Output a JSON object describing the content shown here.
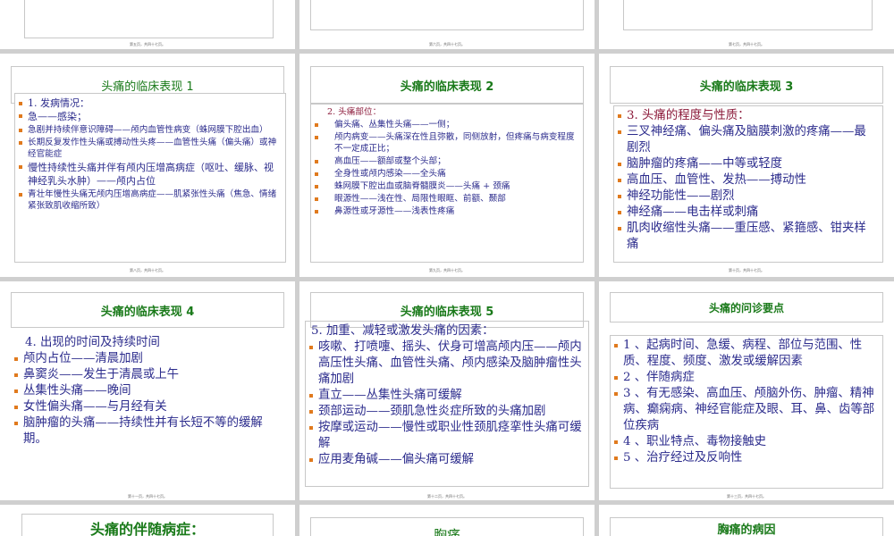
{
  "page_footers": {
    "top_left": "第五页，共四十七页。",
    "top_middle": "第六页，共四十七页。",
    "top_right": "第七页，共四十七页。"
  },
  "top_middle_text": "……………",
  "slides": [
    {
      "title": "头痛的临床表现 1",
      "footer": "第八页，共四十七页。",
      "items": [
        "1. 发病情况：",
        "急——感染；",
        "急剧并持续伴意识障碍——颅内血管性病变（蛛网膜下腔出血）",
        "长期反复发作性头痛或搏动性头疼——血管性头痛（偏头痛）或神经官能症",
        "慢性持续性头痛并伴有颅内压增高病症（呕吐、缓脉、视神经乳头水肿）——颅内占位",
        "青壮年慢性头痛无颅内压增高病症——肌紧张性头痛（焦急、情绪紧张致肌收缩所致）"
      ]
    },
    {
      "title": "头痛的临床表现 2",
      "footer": "第九页，共四十七页。",
      "items": [
        "2. 头痛部位：",
        "偏头痛、丛集性头痛——一侧；",
        "颅内病变——头痛深在性且弥散，同侧放射，但疼痛与病变程度不一定成正比；",
        "高血压——额部或整个头部；",
        "全身性或颅内感染——全头痛",
        "蛛网膜下腔出血或脑脊髓膜炎——头痛 + 颈痛",
        "眼源性——浅在性、局限性眼眶、前额、颞部",
        "鼻源性或牙源性——浅表性疼痛"
      ]
    },
    {
      "title": "头痛的临床表现 3",
      "footer": "第十页，共四十七页。",
      "items": [
        "3. 头痛的程度与性质：",
        "三叉神经痛、偏头痛及脑膜刺激的疼痛——最剧烈",
        "脑肿瘤的疼痛——中等或轻度",
        "高血压、血管性、发热——搏动性",
        "神经功能性——剧烈",
        "神经痛——电击样或刺痛",
        "肌肉收缩性头痛——重压感、紧箍感、钳夹样痛"
      ]
    },
    {
      "title": "头痛的临床表现 4",
      "footer": "第十一页，共四十七页。",
      "items": [
        "4. 出现的时间及持续时间",
        "颅内占位——清晨加剧",
        "鼻窦炎——发生于清晨或上午",
        "丛集性头痛——晚间",
        "女性偏头痛——与月经有关",
        "脑肿瘤的头痛——持续性并有长短不等的缓解期。"
      ]
    },
    {
      "title": "头痛的临床表现 5",
      "footer": "第十二页，共四十七页。",
      "items": [
        "5. 加重、减轻或激发头痛的因素：",
        "咳嗽、打喷嚏、摇头、伏身可增高颅内压——颅内高压性头痛、血管性头痛、颅内感染及脑肿瘤性头痛加剧",
        "直立——丛集性头痛可缓解",
        "颈部运动——颈肌急性炎症所致的头痛加剧",
        "按摩或运动——慢性或职业性颈肌痉挛性头痛可缓解",
        "应用麦角碱——偏头痛可缓解"
      ]
    },
    {
      "title": "头痛的问诊要点",
      "footer": "第十三页，共四十七页。",
      "items": [
        "1 、起病时间、急缓、病程、部位与范围、性质、程度、频度、激发或缓解因素",
        "2 、伴随病症",
        "3 、有无感染、高血压、颅脑外伤、肿瘤、精神病、癫痫病、神经官能症及眼、耳、鼻、齿等部位疾病",
        "4 、职业特点、毒物接触史",
        "5 、治疗经过及反响性"
      ]
    }
  ],
  "bottom_titles": [
    "头痛的伴随病症：",
    "胸痛",
    "胸痛的病因"
  ]
}
